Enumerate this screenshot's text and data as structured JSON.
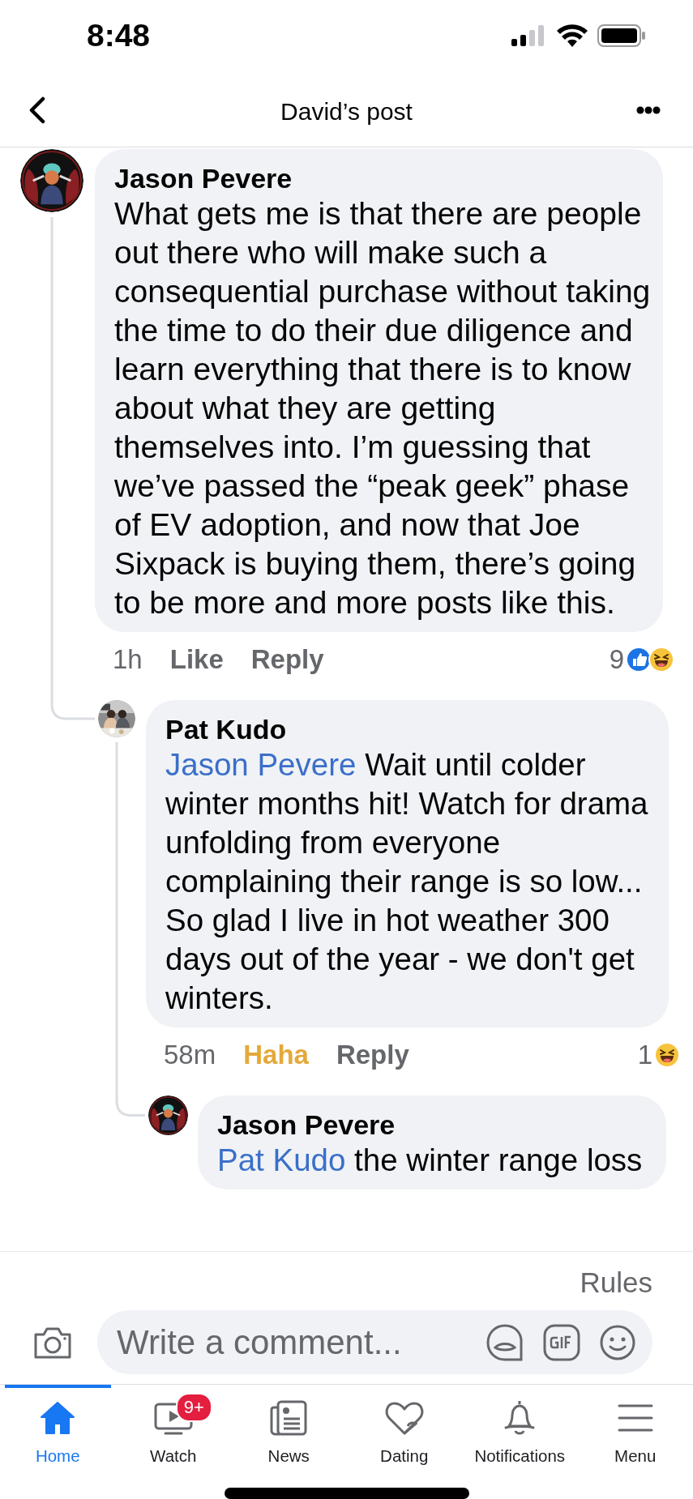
{
  "status_bar": {
    "time": "8:48"
  },
  "header": {
    "title": "David’s post"
  },
  "comments": [
    {
      "author": "Jason Pevere",
      "text": "What gets me is that there are people out there who will make such a consequential purchase without taking the time to do their due diligence and learn everything that there is to know about what they are getting themselves into. I’m guessing that we’ve passed the “peak geek” phase of EV adoption, and now that Joe Sixpack is buying them, there’s going to be more and more posts like this.",
      "time": "1h",
      "actions": [
        {
          "label": "Like",
          "selected": false
        },
        {
          "label": "Reply",
          "selected": false
        }
      ],
      "reaction_count": "9",
      "reactions": [
        {
          "kind": "like"
        },
        {
          "kind": "haha"
        }
      ],
      "children": [
        {
          "author": "Pat Kudo",
          "mention": "Jason Pevere",
          "text": "Wait until colder winter months hit! Watch for drama unfolding from everyone complaining their range is so low... So glad I live in hot weather 300 days out of the year - we don't get winters.",
          "time": "58m",
          "actions": [
            {
              "label": "Haha",
              "selected": true
            },
            {
              "label": "Reply",
              "selected": false
            }
          ],
          "reaction_count": "1",
          "reactions": [
            {
              "kind": "haha"
            }
          ],
          "children": [
            {
              "author": "Jason Pevere",
              "mention": "Pat Kudo",
              "text": "the winter range loss"
            }
          ]
        }
      ]
    }
  ],
  "composer": {
    "rules": "Rules",
    "placeholder": "Write a comment..."
  },
  "tabs": [
    {
      "label": "Home",
      "kind": "home",
      "selected": true
    },
    {
      "label": "Watch",
      "kind": "watch",
      "selected": false,
      "badge": "9+"
    },
    {
      "label": "News",
      "kind": "news",
      "selected": false
    },
    {
      "label": "Dating",
      "kind": "dating",
      "selected": false
    },
    {
      "label": "Notifications",
      "kind": "notifications",
      "selected": false
    },
    {
      "label": "Menu",
      "kind": "menu",
      "selected": false
    }
  ]
}
